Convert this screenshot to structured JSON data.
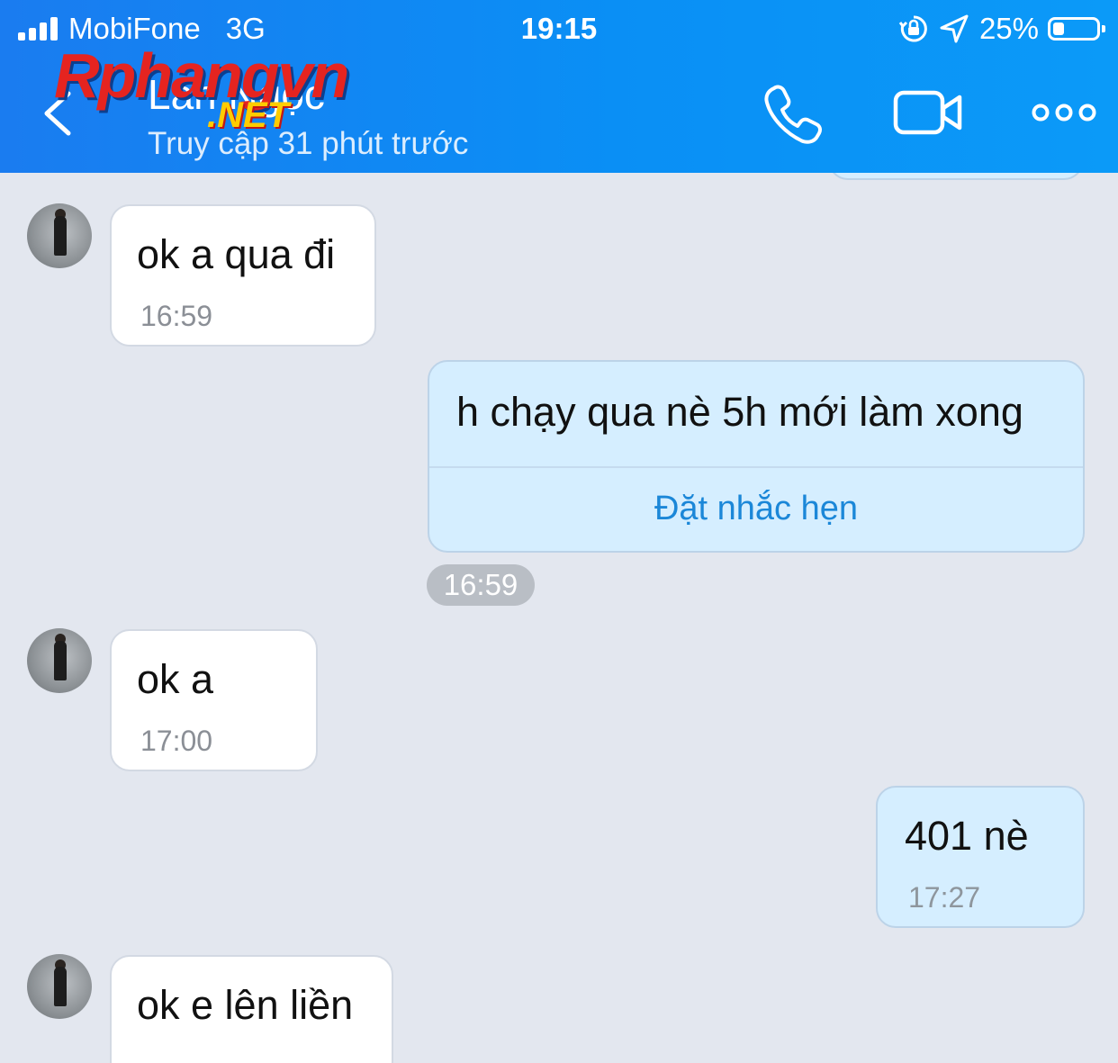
{
  "status_bar": {
    "carrier": "MobiFone",
    "network": "3G",
    "time": "19:15",
    "battery_percent": "25%",
    "battery_level": 0.25
  },
  "header": {
    "contact_name": "Lan Ngọc",
    "last_seen": "Truy cập 31 phút trước",
    "icons": [
      "back-chevron-icon",
      "phone-icon",
      "video-camera-icon",
      "more-options-icon"
    ]
  },
  "watermark": {
    "line1": "Rphangvn",
    "line2": ".NET"
  },
  "messages": [
    {
      "sender": "them",
      "text": "ok a qua đi",
      "time": "16:59"
    },
    {
      "sender": "me",
      "text": "h chạy qua nè 5h mới làm xong",
      "action": "Đặt nhắc hẹn",
      "time": "16:59"
    },
    {
      "sender": "them",
      "text": "ok a",
      "time": "17:00"
    },
    {
      "sender": "me",
      "text": "401 nè",
      "time": "17:27"
    },
    {
      "sender": "them",
      "text": "ok e lên liền"
    }
  ],
  "colors": {
    "header": "#0a8ff5",
    "chat_bg": "#e3e7ef",
    "my_bubble": "#d5eeff",
    "link": "#1b87d8"
  }
}
